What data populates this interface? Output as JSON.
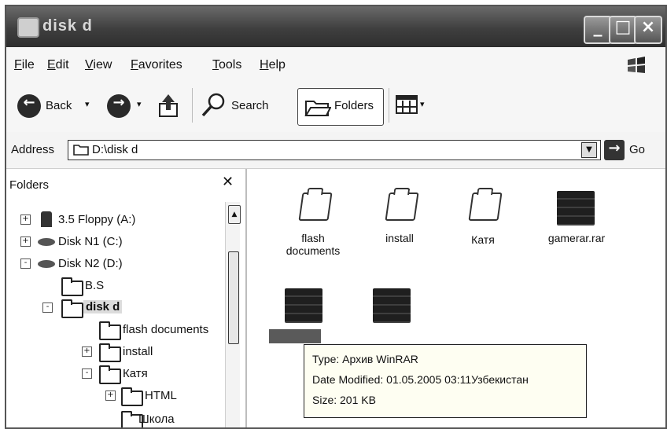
{
  "window": {
    "title": "disk d"
  },
  "menu": [
    "File",
    "Edit",
    "View",
    "Favorites",
    "Tools",
    "Help"
  ],
  "toolbar": {
    "back_label": "Back",
    "search_label": "Search",
    "folders_label": "Folders"
  },
  "address": {
    "label": "Address",
    "value": "D:\\disk d",
    "go_label": "Go"
  },
  "folders_pane": {
    "title": "Folders",
    "tree": [
      {
        "label": "3.5 Floppy (A:)",
        "icon": "floppy-icon",
        "toggle": "+"
      },
      {
        "label": "Disk N1 (C:)",
        "icon": "drive-icon",
        "toggle": "+"
      },
      {
        "label": "Disk N2 (D:)",
        "icon": "drive-icon",
        "toggle": "-"
      },
      {
        "label": "B.S",
        "icon": "folder-icon",
        "toggle": ""
      },
      {
        "label": "disk d",
        "icon": "folder-icon",
        "toggle": "-"
      },
      {
        "label": "flash documents",
        "icon": "folder-icon",
        "toggle": ""
      },
      {
        "label": "install",
        "icon": "folder-icon",
        "toggle": "+"
      },
      {
        "label": "Катя",
        "icon": "folder-icon",
        "toggle": "-"
      },
      {
        "label": "HTML",
        "icon": "folder-icon",
        "toggle": "+"
      },
      {
        "label": "Школа",
        "icon": "folder-icon",
        "toggle": ""
      }
    ]
  },
  "files": [
    {
      "label": "flash documents",
      "type": "folder"
    },
    {
      "label": "install",
      "type": "folder"
    },
    {
      "label": "Катя",
      "type": "folder"
    },
    {
      "label": "gamerar.rar",
      "type": "rar"
    },
    {
      "label": "",
      "type": "rar"
    },
    {
      "label": "",
      "type": "rar"
    }
  ],
  "tooltip": {
    "type": "Type: Архив WinRAR",
    "modified": "Date Modified: 01.05.2005 03:11Узбекистан",
    "size": "Size: 201 KB"
  }
}
